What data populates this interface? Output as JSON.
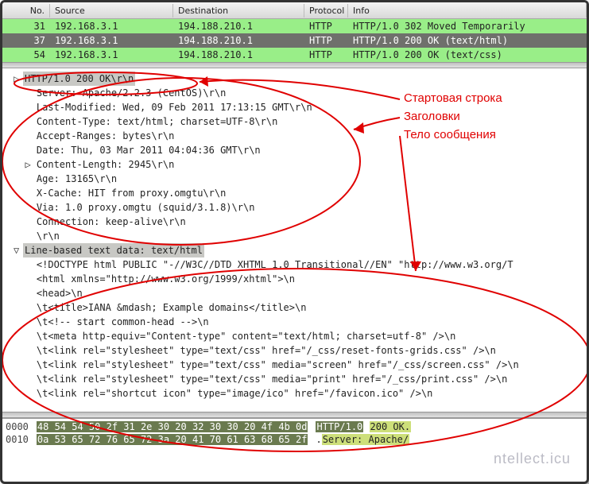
{
  "columns": {
    "no": "No.",
    "source": "Source",
    "destination": "Destination",
    "protocol": "Protocol",
    "info": "Info"
  },
  "packets": [
    {
      "no": "31",
      "src": "192.168.3.1",
      "dst": "194.188.210.1",
      "proto": "HTTP",
      "info": "HTTP/1.0 302 Moved Temporarily",
      "cls": "green"
    },
    {
      "no": "37",
      "src": "192.168.3.1",
      "dst": "194.188.210.1",
      "proto": "HTTP",
      "info": "HTTP/1.0 200 OK  (text/html)",
      "cls": "sel"
    },
    {
      "no": "54",
      "src": "192.168.3.1",
      "dst": "194.188.210.1",
      "proto": "HTTP",
      "info": "HTTP/1.0 200 OK  (text/css)",
      "cls": "green"
    }
  ],
  "detail": {
    "status_hl": "HTTP/1.0 200 OK\\r\\n",
    "headers": [
      "Server: Apache/2.2.3 (CentOS)\\r\\n",
      "Last-Modified: Wed, 09 Feb 2011 17:13:15 GMT\\r\\n",
      "Content-Type: text/html; charset=UTF-8\\r\\n",
      "Accept-Ranges: bytes\\r\\n",
      "Date: Thu, 03 Mar 2011 04:04:36 GMT\\r\\n",
      "Content-Length: 2945\\r\\n",
      "Age: 13165\\r\\n",
      "X-Cache: HIT from proxy.omgtu\\r\\n",
      "Via: 1.0 proxy.omgtu (squid/3.1.8)\\r\\n",
      "Connection: keep-alive\\r\\n",
      "\\r\\n"
    ],
    "content_length_index": 5,
    "body_label": "Line-based text data: text/html",
    "body": [
      "<!DOCTYPE html PUBLIC \"-//W3C//DTD XHTML 1.0 Transitional//EN\" \"http://www.w3.org/T",
      "<html xmlns=\"http://www.w3.org/1999/xhtml\">\\n",
      "<head>\\n",
      "\\t<title>IANA &mdash; Example domains</title>\\n",
      "\\t<!-- start common-head -->\\n",
      "\\t<meta http-equiv=\"Content-type\" content=\"text/html; charset=utf-8\" />\\n",
      "\\t<link rel=\"stylesheet\" type=\"text/css\" href=\"/_css/reset-fonts-grids.css\" />\\n",
      "\\t<link rel=\"stylesheet\" type=\"text/css\" media=\"screen\" href=\"/_css/screen.css\" />\\n",
      "\\t<link rel=\"stylesheet\" type=\"text/css\" media=\"print\" href=\"/_css/print.css\" />\\n",
      "\\t<link rel=\"shortcut icon\" type=\"image/ico\" href=\"/favicon.ico\" />\\n"
    ]
  },
  "hex": {
    "rows": [
      {
        "off": "0000",
        "bytes": "48 54 54 50 2f 31 2e 30  20 32 30 30 20 4f 4b 0d",
        "ascii_pre": "",
        "ascii_hi1": "HTTP/1.0",
        "ascii_mid": " ",
        "ascii_hi2": "200 OK.",
        "ascii_post": ""
      },
      {
        "off": "0010",
        "bytes": "0a 53 65 72 76 65 72 3a  20 41 70 61 63 68 65 2f",
        "ascii_pre": ".",
        "ascii_hi1": "",
        "ascii_mid": "",
        "ascii_hi2": "Server:  Apache/",
        "ascii_post": ""
      }
    ]
  },
  "annotations": {
    "start_line": "Стартовая строка",
    "headers": "Заголовки",
    "body": "Тело сообщения"
  },
  "watermark": "ntellect.icu"
}
